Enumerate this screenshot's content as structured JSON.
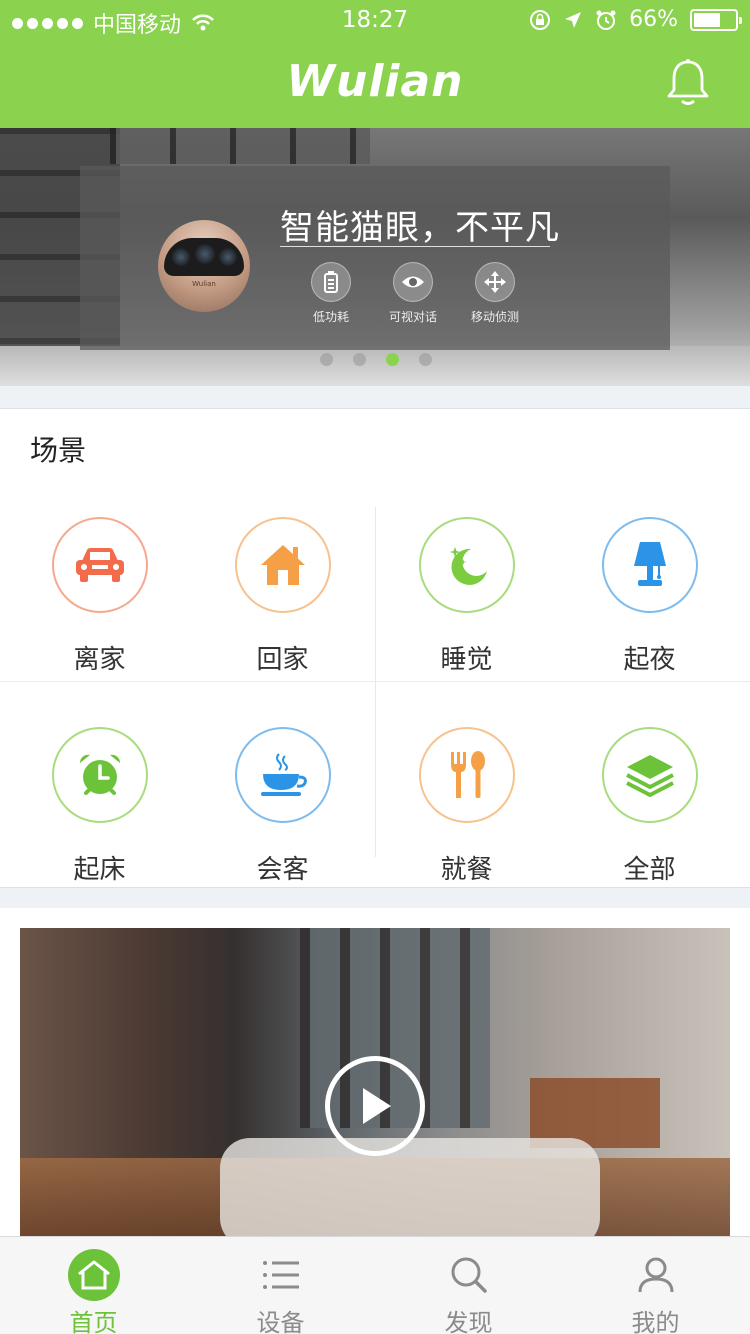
{
  "status_bar": {
    "carrier": "中国移动",
    "time": "18:27",
    "battery": "66%",
    "battery_level": 0.66
  },
  "header": {
    "logo": "Wulian",
    "bell_icon": "bell-icon"
  },
  "banner": {
    "title": "智能猫眼，不平凡",
    "camera_brand": "Wulian",
    "features": [
      {
        "icon": "battery-icon",
        "label": "低功耗"
      },
      {
        "icon": "eye-icon",
        "label": "可视对话"
      },
      {
        "icon": "move-icon",
        "label": "移动侦测"
      }
    ],
    "page_count": 4,
    "active_page": 3
  },
  "scenes": {
    "title": "场景",
    "items": [
      {
        "label": "离家",
        "icon": "car-icon",
        "color": "#f26b4a"
      },
      {
        "label": "回家",
        "icon": "house-icon",
        "color": "#f5a046"
      },
      {
        "label": "睡觉",
        "icon": "moon-icon",
        "color": "#7ccc3f"
      },
      {
        "label": "起夜",
        "icon": "lamp-icon",
        "color": "#2b94e6"
      },
      {
        "label": "起床",
        "icon": "alarm-clock-icon",
        "color": "#6cc33a"
      },
      {
        "label": "会客",
        "icon": "teacup-icon",
        "color": "#2b94e6"
      },
      {
        "label": "就餐",
        "icon": "fork-spoon-icon",
        "color": "#f5a046"
      },
      {
        "label": "全部",
        "icon": "layers-icon",
        "color": "#6cc33a"
      }
    ]
  },
  "video": {
    "play_icon": "play-icon"
  },
  "tabbar": {
    "tabs": [
      {
        "label": "首页",
        "icon": "home-icon",
        "active": true
      },
      {
        "label": "设备",
        "icon": "list-icon",
        "active": false
      },
      {
        "label": "发现",
        "icon": "search-icon",
        "active": false
      },
      {
        "label": "我的",
        "icon": "user-icon",
        "active": false
      }
    ]
  }
}
